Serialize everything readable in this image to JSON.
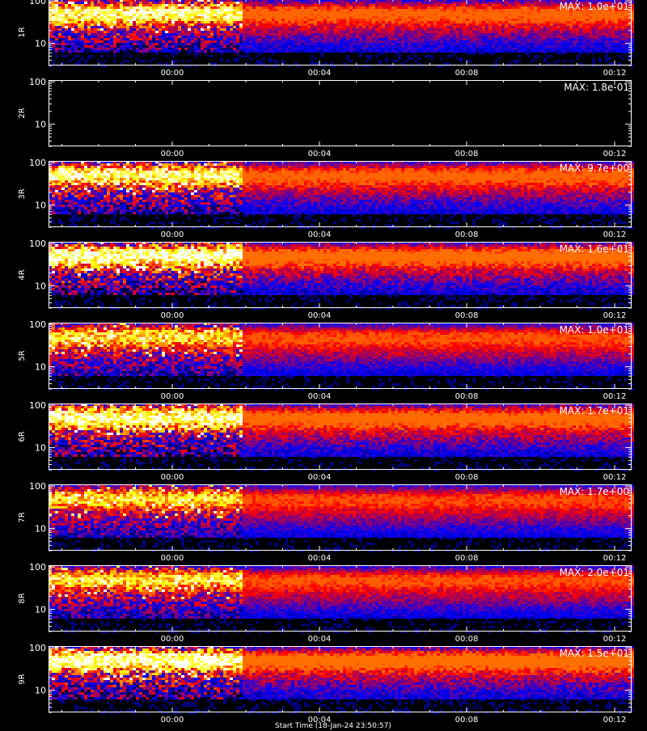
{
  "chart_data": {
    "type": "heatmap",
    "y_scale": "log",
    "ylim": [
      3,
      110
    ],
    "y_ticks": [
      {
        "value": 100,
        "label": "100"
      },
      {
        "value": 10,
        "label": "10"
      }
    ],
    "x_ticks": [
      "00:00",
      "00:04",
      "00:08",
      "00:12"
    ],
    "palette": [
      "#000000",
      "#0000ff",
      "#ff0000",
      "#ffff00",
      "#ffffff"
    ],
    "bottom_label": "Start Time (18-Jan-24 23:50:57)",
    "panels": [
      {
        "ylabel": "1R",
        "max_text": "MAX: 1.0e+01",
        "max": 10.0,
        "peak": 1.0
      },
      {
        "ylabel": "2R",
        "max_text": "MAX: 1.8e-01",
        "max": 0.18,
        "peak": 0.0
      },
      {
        "ylabel": "3R",
        "max_text": "MAX: 9.7e+00",
        "max": 9.7,
        "peak": 1.0
      },
      {
        "ylabel": "4R",
        "max_text": "MAX: 1.6e+01",
        "max": 16.0,
        "peak": 1.15
      },
      {
        "ylabel": "5R",
        "max_text": "MAX: 1.0e+01",
        "max": 10.0,
        "peak": 0.8
      },
      {
        "ylabel": "6R",
        "max_text": "MAX: 1.7e+01",
        "max": 17.0,
        "peak": 1.1
      },
      {
        "ylabel": "7R",
        "max_text": "MAX: 1.7e+00",
        "max": 1.7,
        "peak": 0.75
      },
      {
        "ylabel": "8R",
        "max_text": "MAX: 2.0e+01",
        "max": 20.0,
        "peak": 0.8
      },
      {
        "ylabel": "9R",
        "max_text": "MAX: 1.5e+01",
        "max": 15.0,
        "peak": 1.2
      }
    ]
  }
}
